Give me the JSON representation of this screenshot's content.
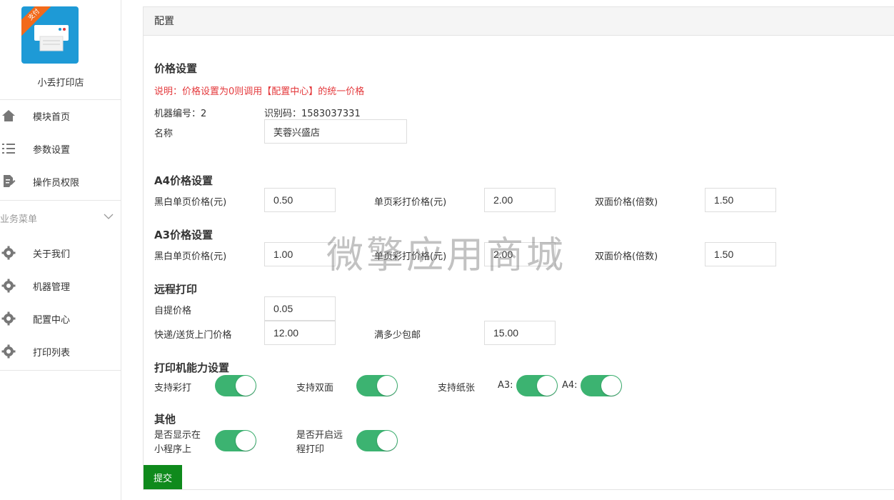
{
  "app": {
    "name": "小丢打印店",
    "logo_ribbon": "支付"
  },
  "sidebar": {
    "top_items": [
      {
        "label": "模块首页",
        "icon": "home-icon"
      },
      {
        "label": "参数设置",
        "icon": "list-icon"
      },
      {
        "label": "操作员权限",
        "icon": "document-edit-icon"
      }
    ],
    "group_title": "业务菜单",
    "group_items": [
      {
        "label": "关于我们",
        "icon": "gear-icon"
      },
      {
        "label": "机器管理",
        "icon": "gear-icon"
      },
      {
        "label": "配置中心",
        "icon": "gear-icon"
      },
      {
        "label": "打印列表",
        "icon": "gear-icon"
      }
    ]
  },
  "panel": {
    "title": "配置",
    "price": {
      "title": "价格设置",
      "note": "说明：价格设置为0则调用【配置中心】的统一价格",
      "machine_no": "机器编号：2",
      "id_code": "识别码：1583037331",
      "name_label": "名称",
      "name_value": "芙蓉兴盛店"
    },
    "a4": {
      "title": "A4价格设置",
      "bw_label": "黑白单页价格(元)",
      "bw_value": "0.50",
      "color_label": "单页彩打价格(元)",
      "color_value": "2.00",
      "duplex_label": "双面价格(倍数)",
      "duplex_value": "1.50"
    },
    "a3": {
      "title": "A3价格设置",
      "bw_label": "黑白单页价格(元)",
      "bw_value": "1.00",
      "color_label": "单页彩打价格(元)",
      "color_value": "2.00",
      "duplex_label": "双面价格(倍数)",
      "duplex_value": "1.50"
    },
    "remote": {
      "title": "远程打印",
      "pickup_label": "自提价格",
      "pickup_value": "0.05",
      "delivery_label": "快递/送货上门价格",
      "delivery_value": "12.00",
      "free_label": "满多少包邮",
      "free_value": "15.00"
    },
    "capability": {
      "title": "打印机能力设置",
      "color_label": "支持彩打",
      "color_on": true,
      "duplex_label": "支持双面",
      "duplex_on": true,
      "paper_label": "支持纸张",
      "a3_label": "A3:",
      "a3_on": true,
      "a4_label": "A4:",
      "a4_on": true
    },
    "other": {
      "title": "其他",
      "show_label_1": "是否显示在",
      "show_label_2": "小程序上",
      "show_on": true,
      "remote_label_1": "是否开启远",
      "remote_label_2": "程打印",
      "remote_on": true
    },
    "submit_label": "提交"
  },
  "watermark": "微擎应用商城",
  "colors": {
    "toggle_on": "#3cb371",
    "submit": "#0f8a1c",
    "note": "#e4393c",
    "logo_bg": "#1e9ad6",
    "ribbon": "#f26a1b"
  }
}
